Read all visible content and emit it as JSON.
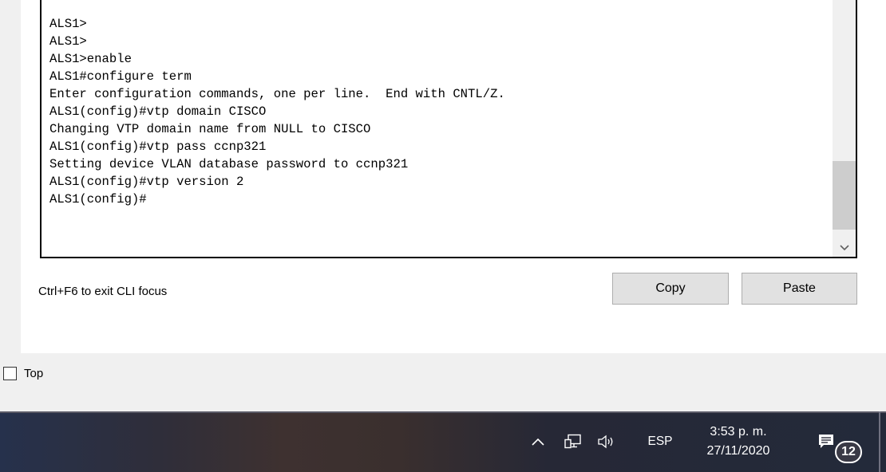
{
  "cli": {
    "lines": [
      "ALS1>",
      "ALS1>",
      "ALS1>enable",
      "ALS1#configure term",
      "Enter configuration commands, one per line.  End with CNTL/Z.",
      "ALS1(config)#vtp domain CISCO",
      "Changing VTP domain name from NULL to CISCO",
      "ALS1(config)#vtp pass ccnp321",
      "Setting device VLAN database password to ccnp321",
      "ALS1(config)#vtp version 2",
      "ALS1(config)#"
    ],
    "hint": "Ctrl+F6 to exit CLI focus",
    "copy_label": "Copy",
    "paste_label": "Paste",
    "scroll_down_icon": "chevron-down-icon"
  },
  "top_checkbox": {
    "label": "Top",
    "checked": false
  },
  "taskbar": {
    "language": "ESP",
    "time": "3:53 p. m.",
    "date": "27/11/2020",
    "notifications_count": "12",
    "icons": [
      "chevron-up-icon",
      "network-icon",
      "volume-icon",
      "notification-icon"
    ]
  }
}
